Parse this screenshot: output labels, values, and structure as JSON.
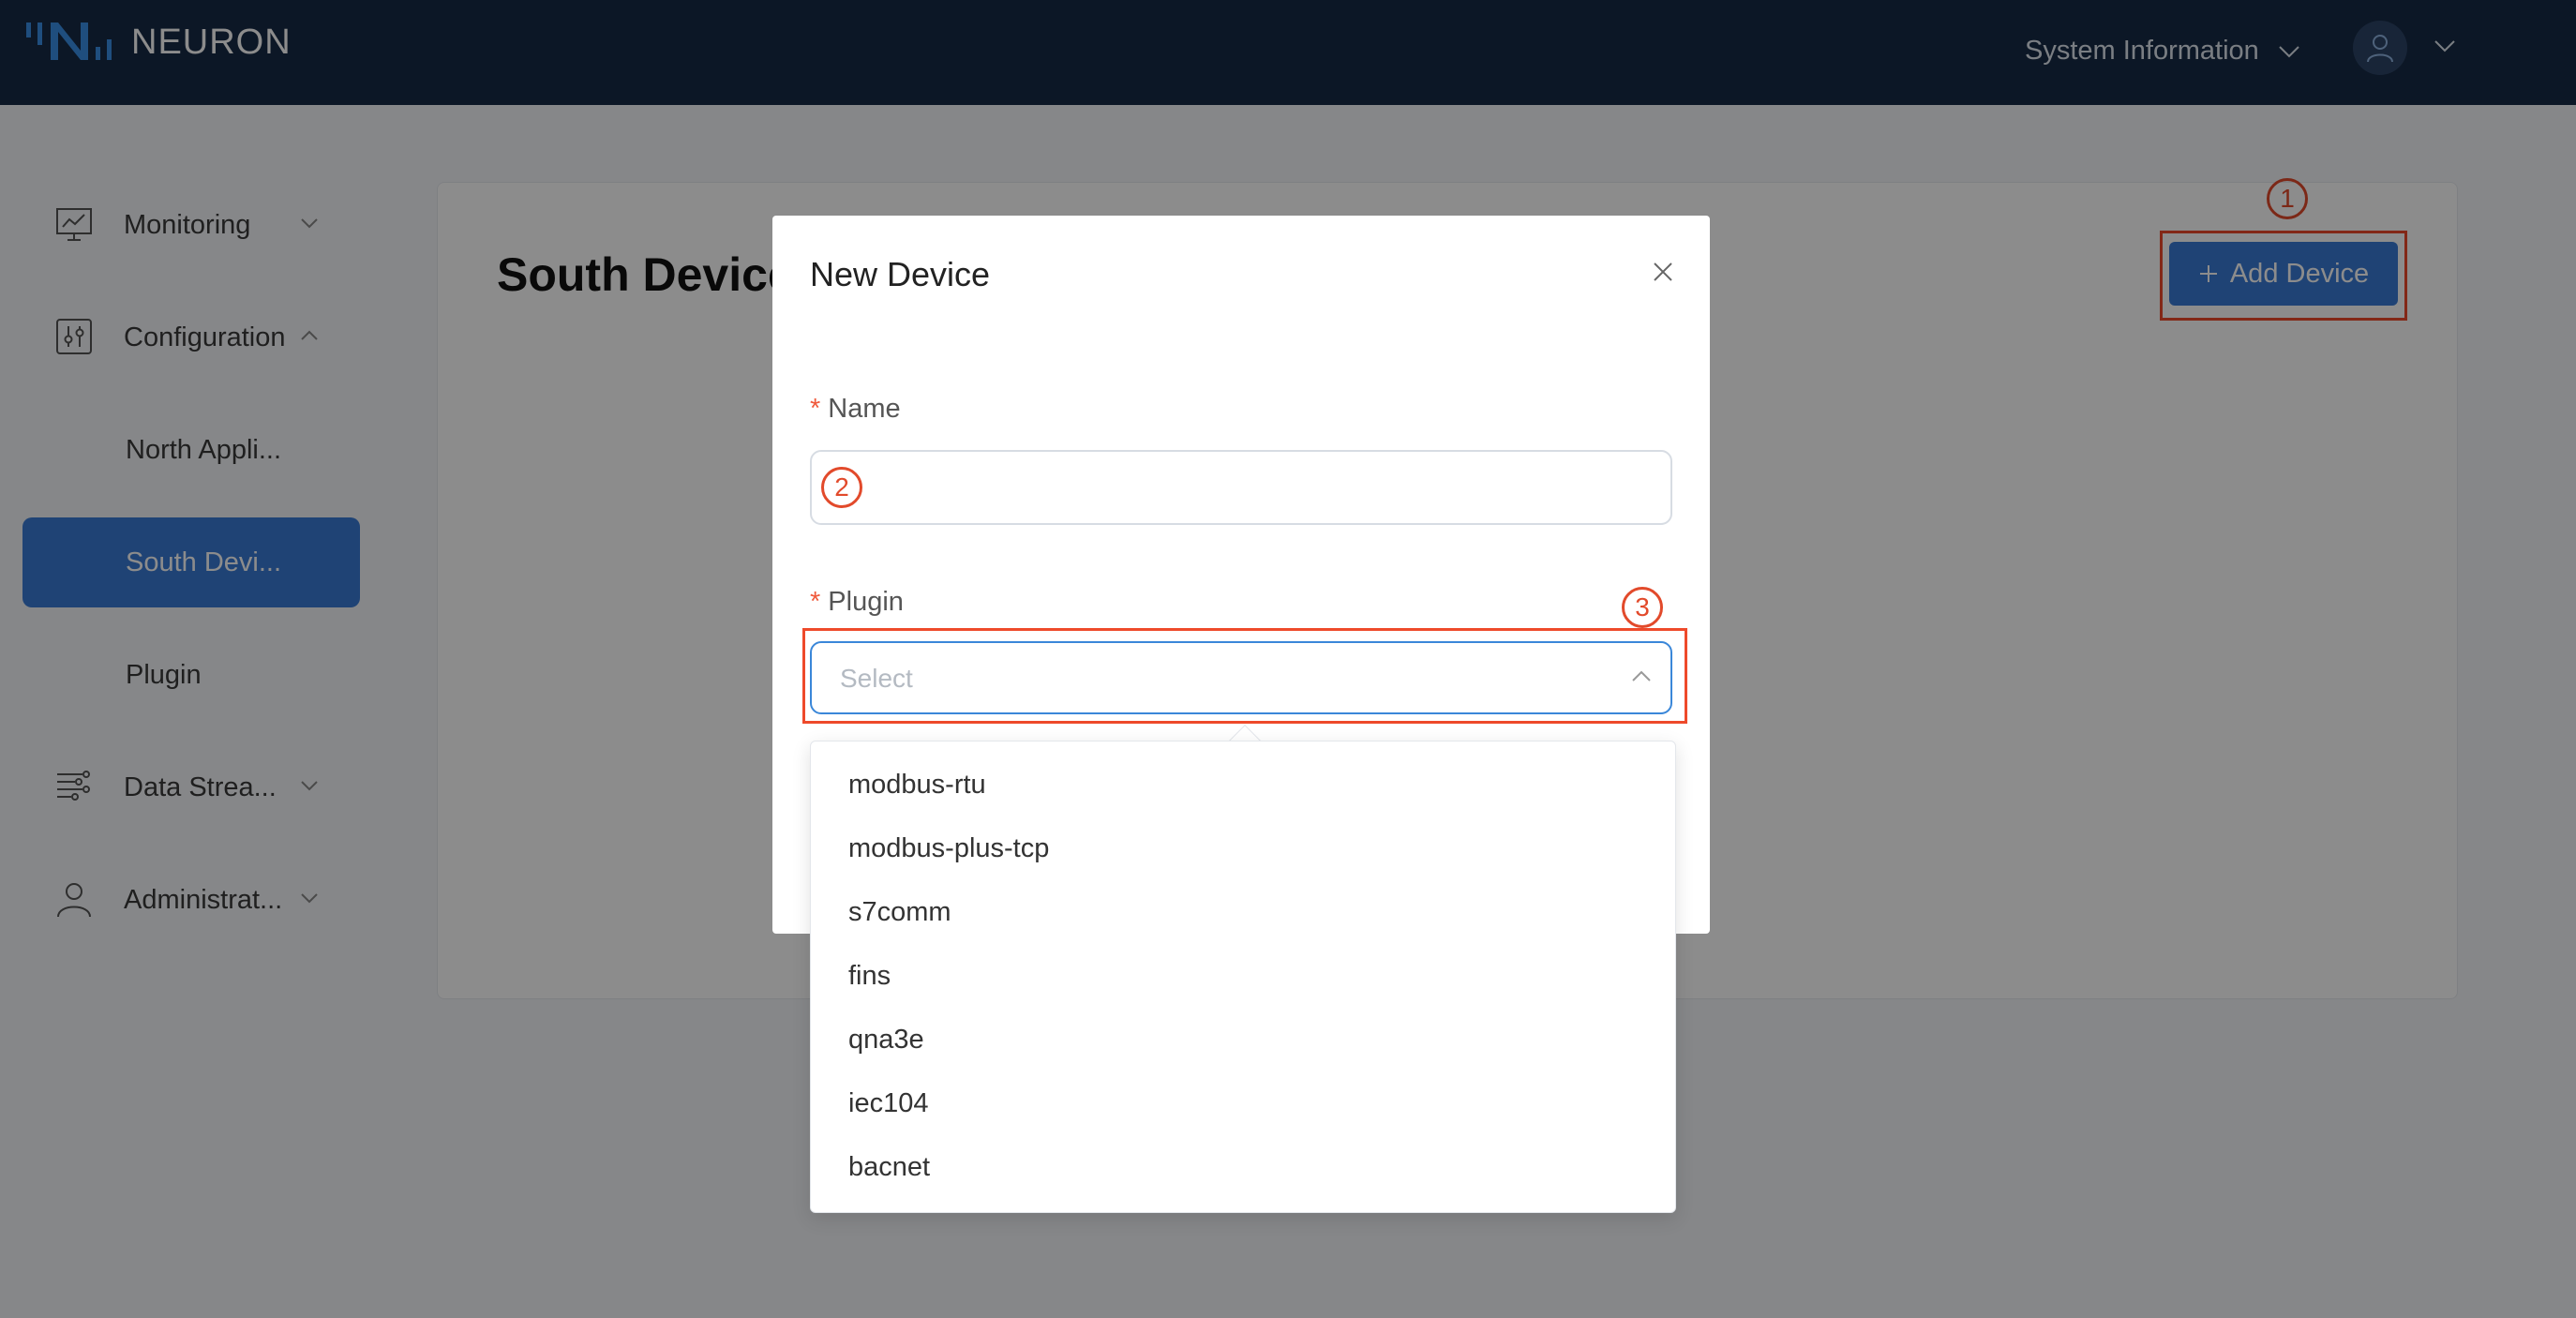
{
  "header": {
    "brand": "NEURON",
    "system_info": "System Information"
  },
  "sidebar": {
    "items": [
      {
        "label": "Monitoring",
        "icon": "monitor-chart-icon"
      },
      {
        "label": "Configuration",
        "icon": "sliders-icon"
      },
      {
        "label": "North Appli..."
      },
      {
        "label": "South Devi..."
      },
      {
        "label": "Plugin"
      },
      {
        "label": "Data Strea...",
        "icon": "data-stream-icon"
      },
      {
        "label": "Administrat...",
        "icon": "user-icon"
      }
    ]
  },
  "page": {
    "title": "South Device",
    "add_button": "Add Device"
  },
  "modal": {
    "title": "New Device",
    "name_label": "Name",
    "plugin_label": "Plugin",
    "plugin_placeholder": "Select",
    "required_mark": "*",
    "plugin_options": [
      "modbus-rtu",
      "modbus-plus-tcp",
      "s7comm",
      "fins",
      "qna3e",
      "iec104",
      "bacnet"
    ]
  },
  "annotations": {
    "step1": "1",
    "step2": "2",
    "step3": "3",
    "highlight_color": "#ee4a2b"
  },
  "colors": {
    "header_bg": "#172a45",
    "primary": "#3a7bd5"
  }
}
